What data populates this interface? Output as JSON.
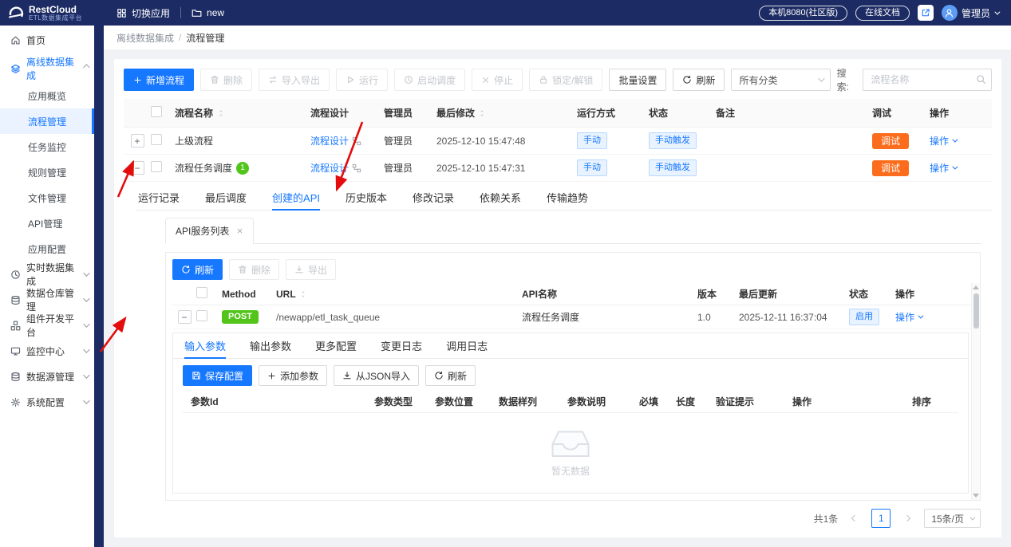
{
  "header": {
    "logo": {
      "name": "RestCloud",
      "subtitle": "ETL数据集成平台"
    },
    "switch_app": "切换应用",
    "workspace": "new",
    "host": "本机8080(社区版)",
    "docs": "在线文档",
    "user": "管理员"
  },
  "breadcrumb": {
    "parent": "离线数据集成",
    "separator": "/",
    "current": "流程管理"
  },
  "sidebar": {
    "items": [
      {
        "label": "首页",
        "icon": "home-icon"
      },
      {
        "label": "离线数据集成",
        "icon": "offline-integration-icon",
        "expanded": true,
        "children": [
          {
            "label": "应用概览"
          },
          {
            "label": "流程管理",
            "active": true
          },
          {
            "label": "任务监控"
          },
          {
            "label": "规则管理"
          },
          {
            "label": "文件管理"
          },
          {
            "label": "API管理"
          },
          {
            "label": "应用配置"
          }
        ]
      },
      {
        "label": "实时数据集成",
        "icon": "realtime-integration-icon"
      },
      {
        "label": "数据仓库管理",
        "icon": "warehouse-icon"
      },
      {
        "label": "组件开发平台",
        "icon": "component-platform-icon"
      },
      {
        "label": "监控中心",
        "icon": "monitor-center-icon"
      },
      {
        "label": "数据源管理",
        "icon": "datasource-icon"
      },
      {
        "label": "系统配置",
        "icon": "gear-icon"
      }
    ]
  },
  "flow_toolbar": {
    "new_flow": "新增流程",
    "delete": "删除",
    "import_export": "导入导出",
    "run": "运行",
    "start_schedule": "启动调度",
    "stop": "停止",
    "lock_unlock": "锁定/解锁",
    "batch_settings": "批量设置",
    "refresh": "刷新",
    "category_filter": "所有分类",
    "search_label": "搜索:",
    "search_placeholder": "流程名称"
  },
  "flow_table": {
    "columns": [
      "流程名称",
      "流程设计",
      "管理员",
      "最后修改",
      "运行方式",
      "状态",
      "备注",
      "调试",
      "操作"
    ],
    "expander_collapsed": "+",
    "expander_expanded": "−",
    "rows": [
      {
        "name": "上级流程",
        "design": "流程设计",
        "admin": "管理员",
        "modified": "2025-12-10 15:47:48",
        "run_mode": "手动",
        "status": "手动触发",
        "remark": "",
        "debug": "调试",
        "action": "操作"
      },
      {
        "name": "流程任务调度",
        "badge": "1",
        "design": "流程设计",
        "admin": "管理员",
        "modified": "2025-12-10 15:47:31",
        "run_mode": "手动",
        "status": "手动触发",
        "remark": "",
        "debug": "调试",
        "action": "操作"
      }
    ]
  },
  "detail": {
    "tabs": [
      "运行记录",
      "最后调度",
      "创建的API",
      "历史版本",
      "修改记录",
      "依赖关系",
      "传输趋势"
    ],
    "active_tab": "创建的API"
  },
  "api_panel": {
    "tab_chip": "API服务列表",
    "refresh": "刷新",
    "delete": "删除",
    "export": "导出",
    "expander_expanded": "−",
    "columns": [
      "Method",
      "URL",
      "API名称",
      "版本",
      "最后更新",
      "状态",
      "操作"
    ],
    "row": {
      "method": "POST",
      "url": "/newapp/etl_task_queue",
      "name": "流程任务调度",
      "version": "1.0",
      "updated": "2025-12-11 16:37:04",
      "status": "启用",
      "action": "操作"
    }
  },
  "param_panel": {
    "tabs": [
      "输入参数",
      "输出参数",
      "更多配置",
      "变更日志",
      "调用日志"
    ],
    "active_tab": "输入参数",
    "save": "保存配置",
    "add": "添加参数",
    "import_json": "从JSON导入",
    "refresh": "刷新",
    "columns": [
      "参数Id",
      "参数类型",
      "参数位置",
      "数据样列",
      "参数说明",
      "必填",
      "长度",
      "验证提示",
      "操作",
      "排序"
    ],
    "empty_text": "暂无数据"
  },
  "pagination": {
    "total": "共1条",
    "current_page": "1",
    "page_size": "15条/页"
  },
  "icons": [
    "restcloud-logo-icon",
    "apps-grid-icon",
    "folder-icon",
    "launch-icon",
    "user-avatar-icon",
    "home-icon",
    "offline-integration-icon",
    "realtime-integration-icon",
    "warehouse-icon",
    "component-platform-icon",
    "monitor-center-icon",
    "datasource-icon",
    "gear-icon",
    "plus-icon",
    "trash-icon",
    "import-export-icon",
    "play-icon",
    "schedule-clock-icon",
    "stop-icon",
    "lock-icon",
    "refresh-icon",
    "search-icon",
    "sort-icon",
    "flow-design-icon",
    "save-icon",
    "download-icon",
    "close-icon",
    "empty-box-icon",
    "annotation-arrows"
  ]
}
